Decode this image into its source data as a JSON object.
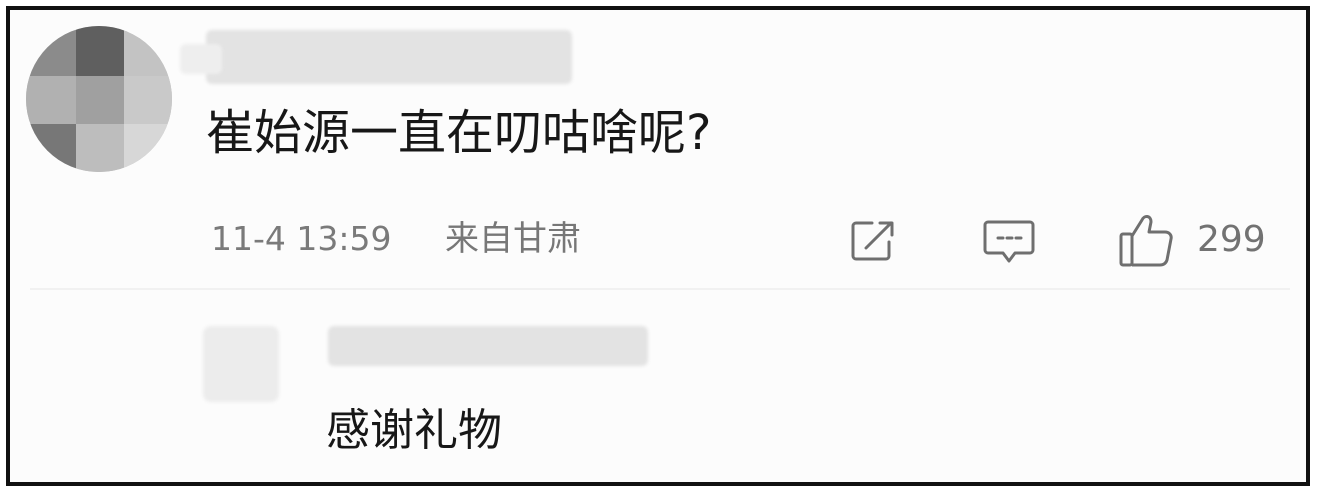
{
  "comment": {
    "text": "崔始源一直在叨咕啥呢?",
    "time": "11-4 13:59",
    "location": "来自甘肃",
    "icons": {
      "share": "edit-share-icon",
      "reply": "comment-icon",
      "like": "thumbs-up-icon"
    },
    "like_count": "299"
  },
  "reply": {
    "text": "感谢礼物"
  },
  "colors": {
    "text_primary": "#171717",
    "text_meta": "#777777",
    "frame_border": "#111111",
    "background": "#fcfcfc"
  }
}
